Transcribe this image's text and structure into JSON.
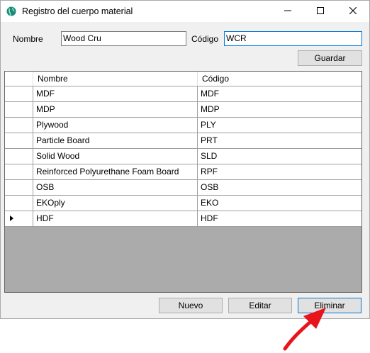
{
  "window": {
    "title": "Registro del cuerpo material"
  },
  "form": {
    "nombre_label": "Nombre",
    "nombre_value": "Wood Cru",
    "codigo_label": "Código",
    "codigo_value": "WCR",
    "guardar_label": "Guardar"
  },
  "grid": {
    "columns": [
      "Nombre",
      "Código"
    ],
    "rows": [
      {
        "nombre": "MDF",
        "codigo": "MDF"
      },
      {
        "nombre": "MDP",
        "codigo": "MDP"
      },
      {
        "nombre": "Plywood",
        "codigo": "PLY"
      },
      {
        "nombre": "Particle Board",
        "codigo": "PRT"
      },
      {
        "nombre": "Solid Wood",
        "codigo": "SLD"
      },
      {
        "nombre": "Reinforced Polyurethane Foam Board",
        "codigo": "RPF"
      },
      {
        "nombre": "OSB",
        "codigo": "OSB"
      },
      {
        "nombre": "EKOply",
        "codigo": "EKO"
      },
      {
        "nombre": "HDF",
        "codigo": "HDF"
      }
    ],
    "current_row_index": 8
  },
  "actions": {
    "nuevo_label": "Nuevo",
    "editar_label": "Editar",
    "eliminar_label": "Eliminar"
  },
  "icons": {
    "app": "globe-icon",
    "minimize": "minimize-icon",
    "maximize": "maximize-icon",
    "close": "close-icon",
    "annotation": "red-arrow-icon",
    "current_row": "row-indicator-icon"
  },
  "colors": {
    "window_bg": "#f0f0f0",
    "grid_empty_bg": "#ababab",
    "focus_border": "#0078d7",
    "annotation_red": "#e8141c"
  }
}
